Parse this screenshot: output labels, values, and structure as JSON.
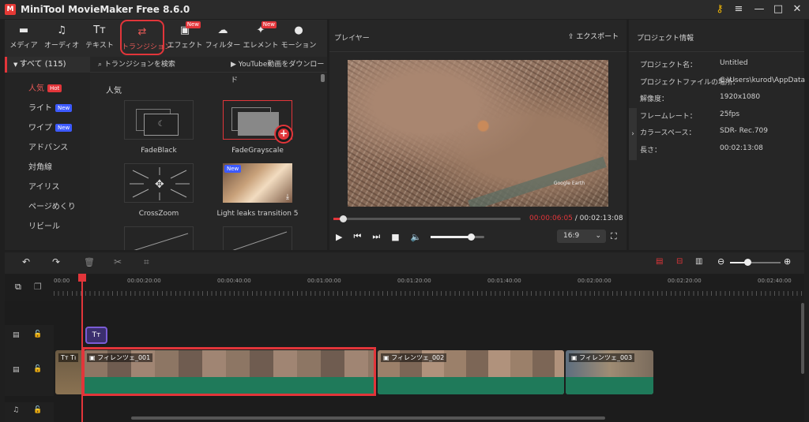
{
  "app": {
    "title": "MiniTool MovieMaker Free 8.6.0"
  },
  "toolbar": [
    {
      "label": "メディア",
      "icon": "folder-icon",
      "glyph": "▬",
      "new": false,
      "selected": false
    },
    {
      "label": "オーディオ",
      "icon": "music-note-icon",
      "glyph": "♫",
      "new": false,
      "selected": false
    },
    {
      "label": "テキスト",
      "icon": "text-icon",
      "glyph": "Tт",
      "new": false,
      "selected": false
    },
    {
      "label": "トランジション",
      "icon": "transition-icon",
      "glyph": "⇄",
      "new": false,
      "selected": true
    },
    {
      "label": "エフェクト",
      "icon": "effect-icon",
      "glyph": "▣",
      "new": true,
      "selected": false
    },
    {
      "label": "フィルター",
      "icon": "filter-icon",
      "glyph": "☁",
      "new": false,
      "selected": false
    },
    {
      "label": "エレメント",
      "icon": "element-icon",
      "glyph": "✦",
      "new": true,
      "selected": false
    },
    {
      "label": "モーション",
      "icon": "motion-icon",
      "glyph": "●",
      "new": false,
      "selected": false
    }
  ],
  "new_tag": "New",
  "nav": {
    "all_label": "すべて (115)",
    "items": [
      {
        "label": "人気",
        "tag": "Hot"
      },
      {
        "label": "ライト",
        "tag": "New"
      },
      {
        "label": "ワイプ",
        "tag": "New"
      },
      {
        "label": "アドバンス",
        "tag": ""
      },
      {
        "label": "対角線",
        "tag": ""
      },
      {
        "label": "アイリス",
        "tag": ""
      },
      {
        "label": "ページめくり",
        "tag": ""
      },
      {
        "label": "リビール",
        "tag": ""
      }
    ]
  },
  "browser": {
    "search": "トランジションを検索",
    "youtube": "YouTube動画をダウンロード",
    "section": "人気",
    "items": [
      "FadeBlack",
      "FadeGrayscale",
      "CrossZoom",
      "Light leaks transition 5"
    ],
    "new_badge": "New"
  },
  "player": {
    "title": "プレイヤー",
    "export": "エクスポート",
    "current_time": "00:00:06:05",
    "separator": " / ",
    "total_time": "00:02:13:08",
    "aspect": "16:9",
    "watermark": "Google Earth",
    "progress": 0.05,
    "volume": 0.75
  },
  "info": {
    "title": "プロジェクト情報",
    "rows": [
      {
        "k": "プロジェクト名：",
        "v": "Untitled"
      },
      {
        "k": "プロジェクトファイルの場所：",
        "v": "C:\\Users\\kurod\\AppData"
      },
      {
        "k": "解像度：",
        "v": "1920x1080"
      },
      {
        "k": "フレームレート：",
        "v": "25fps"
      },
      {
        "k": "カラースペース：",
        "v": "SDR- Rec.709"
      },
      {
        "k": "長さ：",
        "v": "00:02:13:08"
      }
    ]
  },
  "ruler": [
    "00:00",
    "00:00:20:00",
    "00:00:40:00",
    "00:01:00:00",
    "00:01:20:00",
    "00:01:40:00",
    "00:02:00:00",
    "00:02:20:00",
    "00:02:40:00"
  ],
  "clips": [
    "フィレンツェ_001",
    "フィレンツェ_002",
    "フィレンツェ_003"
  ],
  "text_clip": "Tт",
  "title_clip": "Tт  Tı",
  "colors": {
    "accent": "#e2353a",
    "audio": "#1f7a5a",
    "text_clip": "#7b5cd6"
  }
}
